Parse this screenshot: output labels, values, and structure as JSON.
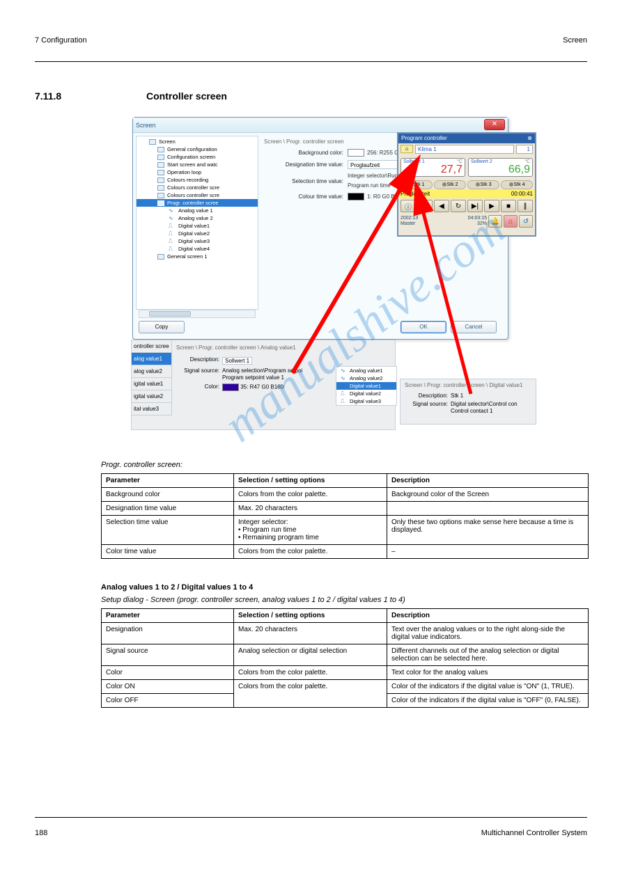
{
  "header": {
    "left": "7 Configuration",
    "right": "Screen"
  },
  "section": {
    "number": "7.11.8",
    "title": "Controller screen"
  },
  "dialog": {
    "title": "Screen",
    "breadcrumb": "Screen \\ Progr. controller screen",
    "tree": {
      "root": "Screen",
      "items": [
        "General configuration",
        "Configuration screen",
        "Start screen and watc",
        "Operation loop",
        "Colours recording",
        "Colours controller scre",
        "Colours controller scre"
      ],
      "selected": "Progr. controller scree",
      "subitems": [
        "Analog value 1",
        "Analog value 2",
        "Digital value1",
        "Digital value2",
        "Digital value3",
        "Digital value4"
      ],
      "tail": [
        "General screen 1"
      ]
    },
    "form": {
      "bg_lbl": "Background color:",
      "bg_val": "256: R255 G255 B255",
      "desig_lbl": "Designation time value:",
      "desig_val": "Proglaufzeit",
      "seltime_lbl": "Selection time value:",
      "seltime_val": "Integer selector\\Run times\nProgram run time",
      "seltime_val_line1": "Integer selector\\Run times",
      "seltime_val_line2": "Program run time",
      "coltime_lbl": "Colour time value:",
      "coltime_val": "1: R0 G0 B0"
    },
    "buttons": {
      "copy": "Copy",
      "ok": "OK",
      "cancel": "Cancel"
    }
  },
  "preview": {
    "title": "Program controller",
    "klima": "Klima 1",
    "klima_id": "1",
    "v1": {
      "label": "Sollwert 1",
      "unit": "°C",
      "value": "27,7"
    },
    "v2": {
      "label": "Sollwert 2",
      "unit": "°C",
      "value": "66,9"
    },
    "stk": [
      "Stk 1",
      "Stk 2",
      "Stk 3",
      "Stk 4"
    ],
    "progline": {
      "label": "Proglaufzeit",
      "time": "00:00:41"
    },
    "status": {
      "left_top": "2002:13",
      "left_bot": "Master",
      "right_top": "04:03:15",
      "right_bot": "32%"
    }
  },
  "sub_analog": {
    "nav": [
      "ontroller scree",
      "alog value1",
      "alog value2",
      "igital value1",
      "igital value2",
      "ital value3"
    ],
    "bc": "Screen \\ Progr. controller screen \\ Analog value1",
    "desc_lbl": "Description:",
    "desc_val": "Sollwert 1",
    "src_lbl": "Signal source:",
    "src_val1": "Analog selection\\Program setpoi",
    "src_val2": "Program setpoint value 1",
    "col_lbl": "Color:",
    "col_val": "35: R47 G0 B160"
  },
  "sub_tree": {
    "items": [
      "Analog value1",
      "Analog value2",
      "Digital value1",
      "Digital value2",
      "Digital value3"
    ],
    "sel": 2
  },
  "sub_digital": {
    "bc": "Screen \\ Progr. controller screen \\ Digital value1",
    "desc_lbl": "Description:",
    "desc_val": "Stk 1",
    "src_lbl": "Signal source:",
    "src_val1": "Digital selector\\Control con",
    "src_val2": "Control contact 1"
  },
  "table1": {
    "caption": "Progr. controller screen:",
    "head": [
      "Parameter",
      "Selection / setting options",
      "Description"
    ],
    "rows": [
      [
        "Background color",
        "Colors from the color palette.",
        "Background color of the Screen"
      ],
      [
        "Designation time value",
        "Max. 20 characters",
        ""
      ],
      [
        "Selection time value",
        "Integer selector:\n• Program run time\n• Remaining program time",
        "Only these two options make sense here because a time is displayed."
      ],
      [
        "Color time value",
        "Colors from the color palette.",
        "–"
      ]
    ]
  },
  "table2": {
    "title": "Analog values 1 to 2 / Digital values 1 to 4",
    "caption": "Setup dialog - Screen (progr. controller screen, analog values 1 to 2 / digital values 1 to 4)",
    "head": [
      "Parameter",
      "Selection / setting options",
      "Description"
    ],
    "rows": [
      [
        "Designation",
        "Max. 20 characters",
        "Text over the analog values or to the right along-side the digital value indicators."
      ],
      [
        "Signal source",
        "Analog selection or digital selection",
        "Different channels out of the analog selection or digital selection can be selected here."
      ],
      [
        "Color",
        "Colors from the color palette.",
        "Text color for the analog values"
      ],
      [
        "Color ON",
        "Colors from the color palette.",
        "Color of the indicators if the digital value is \"ON\" (1, TRUE)."
      ],
      [
        "Color OFF",
        "",
        "Color of the indicators if the digital value is \"OFF\" (0, FALSE)."
      ]
    ]
  },
  "footer": {
    "page": "188",
    "text": "Multichannel Controller System"
  },
  "watermark": "manualshive.com"
}
